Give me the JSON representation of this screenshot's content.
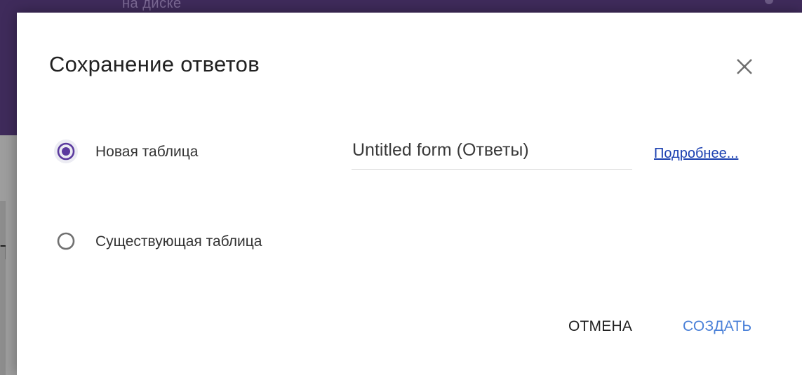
{
  "background": {
    "header_text": "на диске"
  },
  "dialog": {
    "title": "Сохранение ответов",
    "close_icon": "close-icon",
    "options": [
      {
        "label": "Новая таблица",
        "selected": true
      },
      {
        "label": "Существующая таблица",
        "selected": false
      }
    ],
    "sheet_name": "Untitled form (Ответы)",
    "learn_more": "Подробнее...",
    "cancel_label": "ОТМЕНА",
    "create_label": "СОЗДАТЬ"
  },
  "colors": {
    "accent": "#5b3a9e",
    "header": "#3f2b5b",
    "primary_button": "#4a80d8",
    "link": "#1a3fb0"
  }
}
